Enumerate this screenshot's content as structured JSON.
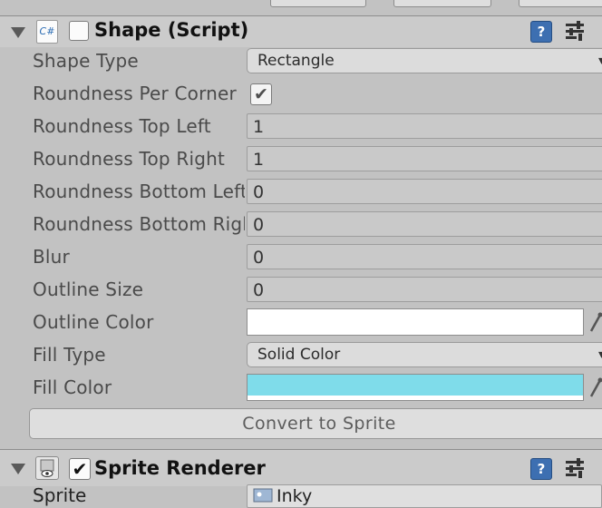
{
  "shape_component": {
    "script_icon_label": "C#",
    "title": "Shape (Script)",
    "enabled": false,
    "icons": [
      "foldout-arrow-icon",
      "script-icon",
      "help-icon",
      "settings-icon"
    ],
    "properties": {
      "shape_type": {
        "label": "Shape Type",
        "value": "Rectangle"
      },
      "roundness_per_corner": {
        "label": "Roundness Per Corner",
        "checked": true,
        "check_glyph": "✔"
      },
      "roundness_top_left": {
        "label": "Roundness Top Left",
        "value": "1"
      },
      "roundness_top_right": {
        "label": "Roundness Top Right",
        "value": "1"
      },
      "roundness_bottom_left": {
        "label": "Roundness Bottom Left",
        "value": "0"
      },
      "roundness_bottom_right": {
        "label": "Roundness Bottom Right",
        "value": "0"
      },
      "blur": {
        "label": "Blur",
        "value": "0"
      },
      "outline_size": {
        "label": "Outline Size",
        "value": "0"
      },
      "outline_color": {
        "label": "Outline Color",
        "color": "#ffffff"
      },
      "fill_type": {
        "label": "Fill Type",
        "value": "Solid Color"
      },
      "fill_color": {
        "label": "Fill Color",
        "color": "#7fdcea"
      }
    },
    "convert_button_label": "Convert to Sprite"
  },
  "sprite_renderer": {
    "title": "Sprite Renderer",
    "enabled": true,
    "enabled_glyph": "✔",
    "icons": [
      "foldout-arrow-icon",
      "sprite-renderer-icon",
      "help-icon",
      "settings-icon"
    ],
    "sprite": {
      "label": "Sprite",
      "value": "Inky"
    }
  },
  "help_glyph": "?",
  "dropdown_glyph": "▾",
  "colors": {
    "inspector_bg": "#c2c2c2",
    "header_bg": "#cbcbcb",
    "help_blue": "#3d6fb1"
  }
}
